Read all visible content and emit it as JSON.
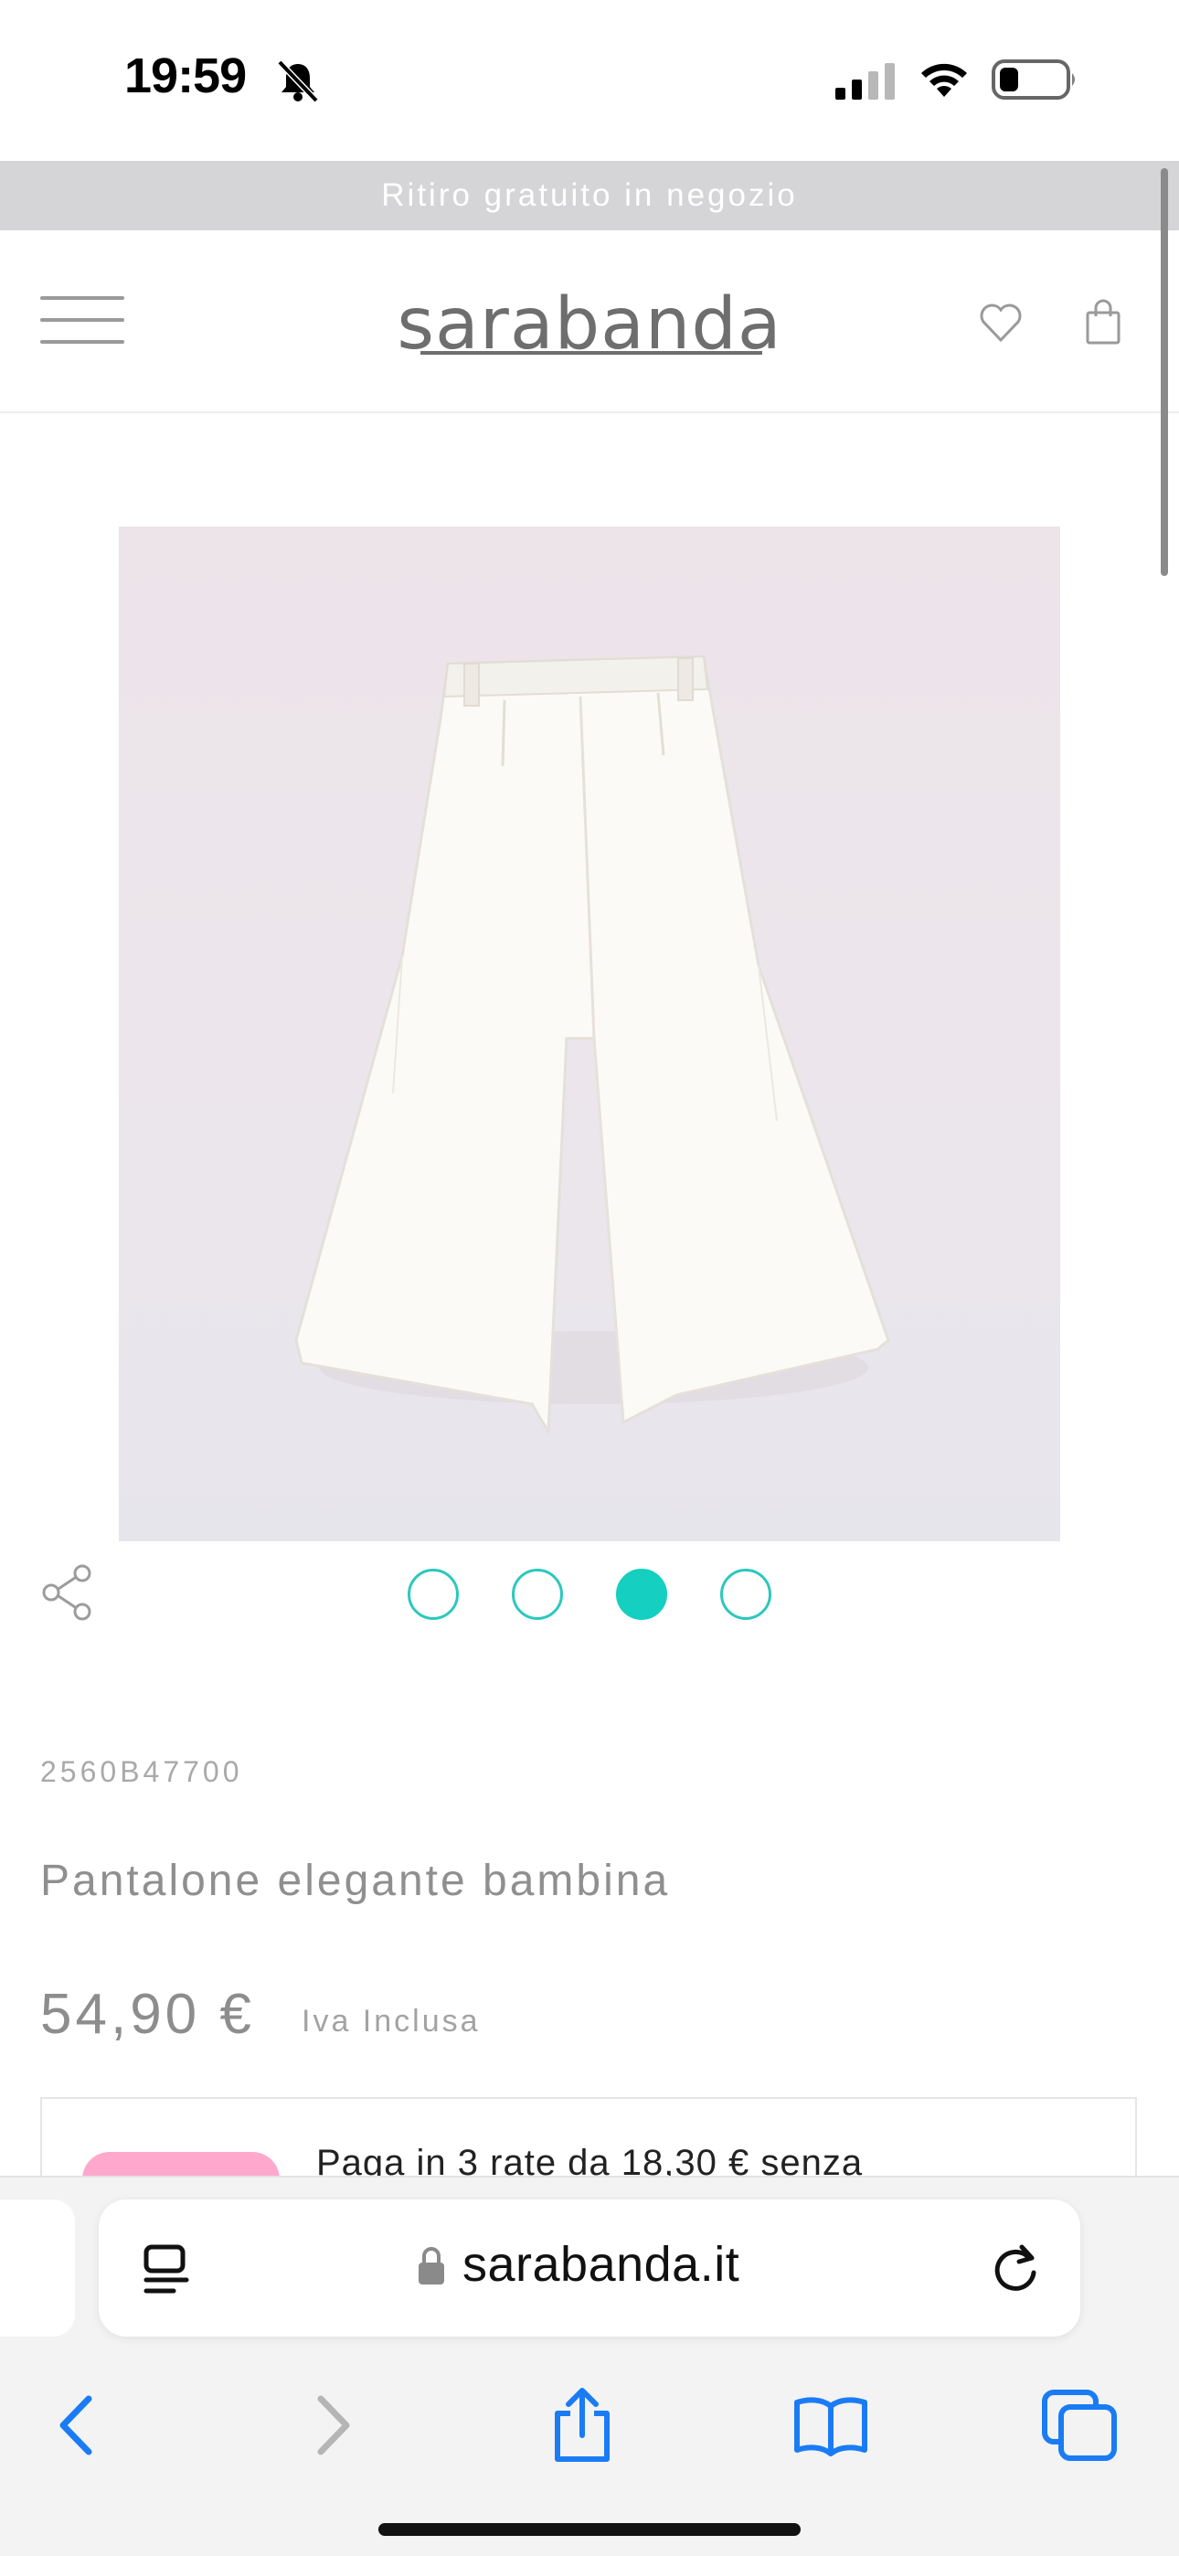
{
  "status_bar": {
    "time": "19:59"
  },
  "promo": {
    "text": "Ritiro gratuito in negozio"
  },
  "header": {
    "logo": "sarabanda"
  },
  "product": {
    "sku": "2560B47700",
    "title": "Pantalone elegante bambina",
    "price": "54,90 €",
    "vat_note": "Iva Inclusa",
    "gallery": {
      "count": 4,
      "active_index": 2
    }
  },
  "installments": {
    "text": "Paga in 3 rate da 18,30 € senza"
  },
  "browser": {
    "url": "sarabanda.it"
  },
  "colors": {
    "accent": "#15cfc1",
    "promo_bg": "#d5d5d7",
    "klarna": "#ffa8cd",
    "ios_blue": "#1a7cf5"
  },
  "icons": [
    "bell-slash-icon",
    "signal-icon",
    "wifi-icon",
    "battery-icon",
    "menu-icon",
    "heart-icon",
    "bag-icon",
    "share-icon",
    "reader-icon",
    "lock-icon",
    "reload-icon",
    "back-icon",
    "forward-icon",
    "share-sheet-icon",
    "bookmarks-icon",
    "tabs-icon"
  ]
}
